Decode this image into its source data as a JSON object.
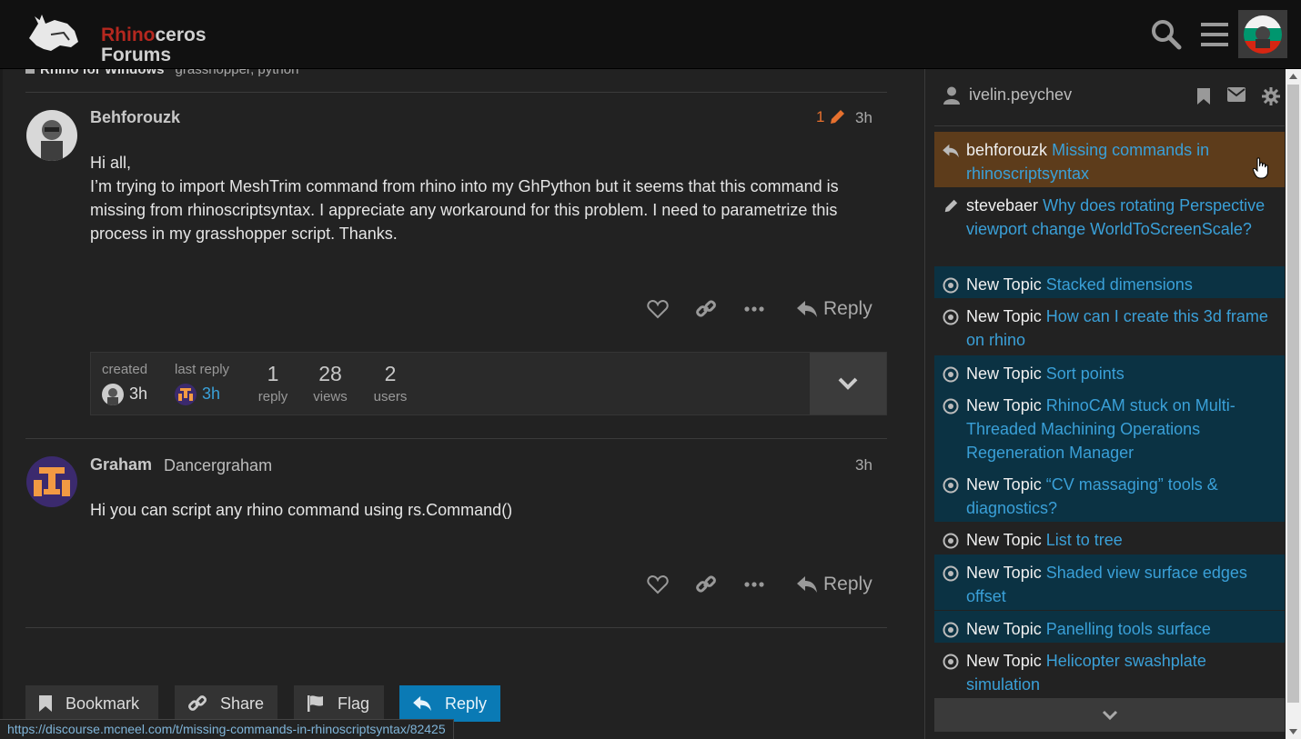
{
  "header": {
    "logo_line1_a": "Rhino",
    "logo_line1_b": "ceros",
    "logo_line2": "Forums"
  },
  "breadcrumb": {
    "category": "Rhino for Windows",
    "tags": "grasshopper, python"
  },
  "post1": {
    "username": "Behforouzk",
    "edit_count": "1",
    "time": "3h",
    "body": [
      "Hi all,",
      "I’m trying to import MeshTrim command from rhino into my GhPython but it seems that this command is missing from rhinoscriptsyntax. I appreciate any workaround for this problem. I need to parametrize this process in my grasshopper script. Thanks."
    ],
    "reply_label": "Reply"
  },
  "topic_meta": {
    "created_label": "created",
    "created_time": "3h",
    "last_reply_label": "last reply",
    "last_reply_time": "3h",
    "replies_count": "1",
    "replies_label": "reply",
    "views_count": "28",
    "views_label": "views",
    "users_count": "2",
    "users_label": "users"
  },
  "post2": {
    "username": "Graham",
    "full_name": "Dancergraham",
    "time": "3h",
    "body": "Hi you can script any rhino command using rs.Command()",
    "reply_label": "Reply"
  },
  "footer_buttons": {
    "bookmark": "Bookmark",
    "share": "Share",
    "flag": "Flag",
    "reply": "Reply"
  },
  "status_url": "https://discourse.mcneel.com/t/missing-commands-in-rhinoscriptsyntax/82425",
  "panel": {
    "username": "ivelin.peychev",
    "notifications": [
      {
        "icon": "reply-icon",
        "who": "behforouzk",
        "title": "Missing commands in rhinoscriptsyntax",
        "state": "highlight"
      },
      {
        "icon": "pencil-icon",
        "who": "stevebaer",
        "title": "Why does rotating Perspective viewport change WorldToScreenScale?",
        "state": "read"
      },
      {
        "icon": "dot-circle-icon",
        "who": "New Topic",
        "title": "Stacked dimensions",
        "state": "unread"
      },
      {
        "icon": "dot-circle-icon",
        "who": "New Topic",
        "title": "How can I create this 3d frame on rhino",
        "state": "read"
      },
      {
        "icon": "dot-circle-icon",
        "who": "New Topic",
        "title": "Sort points",
        "state": "unread"
      },
      {
        "icon": "dot-circle-icon",
        "who": "New Topic",
        "title": "RhinoCAM stuck on Multi-Threaded Machining Operations Regeneration Manager",
        "state": "unread"
      },
      {
        "icon": "dot-circle-icon",
        "who": "New Topic",
        "title": "“CV massaging” tools & diagnostics?",
        "state": "unread"
      },
      {
        "icon": "dot-circle-icon",
        "who": "New Topic",
        "title": "List to tree",
        "state": "read"
      },
      {
        "icon": "dot-circle-icon",
        "who": "New Topic",
        "title": "Shaded view surface edges offset",
        "state": "unread"
      },
      {
        "icon": "dot-circle-icon",
        "who": "New Topic",
        "title": "Panelling tools surface",
        "state": "unread"
      },
      {
        "icon": "dot-circle-icon",
        "who": "New Topic",
        "title": "Helicopter swashplate simulation",
        "state": "read"
      }
    ]
  },
  "colors": {
    "background": "#222222",
    "header": "#111111",
    "link": "#3aa0d8",
    "unread_bg": "#0b3243",
    "highlight_bg": "#5d3c1b",
    "primary_button": "#0a7ab5",
    "edit_orange": "#e6702e"
  }
}
